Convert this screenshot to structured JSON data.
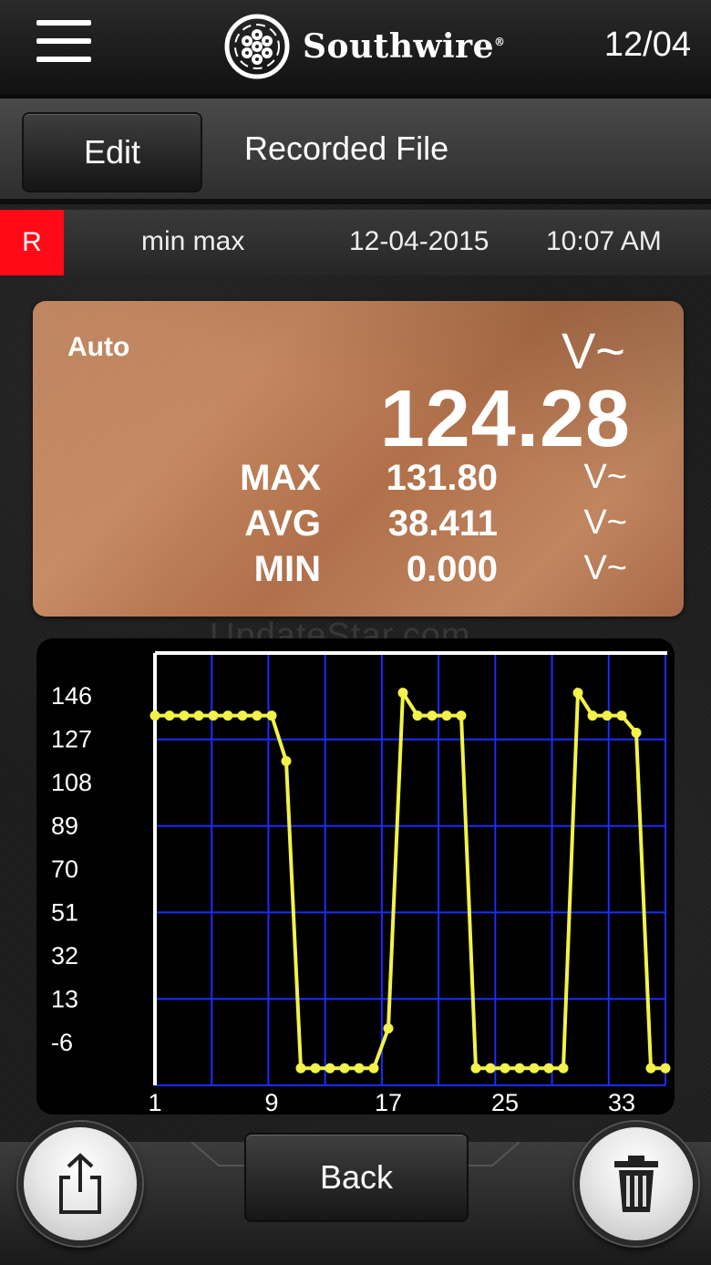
{
  "header": {
    "brand": "Southwire",
    "brand_mark": "®",
    "date": "12/04"
  },
  "titlebar": {
    "edit_label": "Edit",
    "title": "Recorded File"
  },
  "infobar": {
    "badge": "R",
    "mode": "min max",
    "date": "12-04-2015",
    "time": "10:07 AM"
  },
  "reading": {
    "range": "Auto",
    "unit": "V~",
    "value": "124.28",
    "stats": [
      {
        "label": "MAX",
        "value": "131.80",
        "unit": "V~"
      },
      {
        "label": "AVG",
        "value": "38.411",
        "unit": "V~"
      },
      {
        "label": "MIN",
        "value": "0.000",
        "unit": "V~"
      }
    ]
  },
  "watermark": "UpdateStar.com",
  "chart_data": {
    "type": "line",
    "title": "",
    "xlabel": "",
    "ylabel": "",
    "x_ticks": [
      "1",
      "9",
      "17",
      "25",
      "33"
    ],
    "y_ticks": [
      "146",
      "127",
      "108",
      "89",
      "70",
      "51",
      "32",
      "13",
      "-6"
    ],
    "xlim": [
      1,
      36
    ],
    "ylim": [
      -6,
      146
    ],
    "grid": true,
    "series": [
      {
        "color": "#f2f24a",
        "x": [
          1,
          2,
          3,
          4,
          5,
          6,
          7,
          8,
          9,
          10,
          11,
          12,
          13,
          14,
          15,
          16,
          17,
          18,
          19,
          20,
          21,
          22,
          23,
          24,
          25,
          26,
          27,
          28,
          29,
          30,
          31,
          32,
          33,
          34,
          35,
          36
        ],
        "y": [
          124,
          124,
          124,
          124,
          124,
          124,
          124,
          124,
          124,
          108,
          0,
          0,
          0,
          0,
          0,
          0,
          14,
          132,
          124,
          124,
          124,
          124,
          0,
          0,
          0,
          0,
          0,
          0,
          0,
          132,
          124,
          124,
          124,
          118,
          0,
          0
        ]
      }
    ]
  },
  "colors": {
    "accent_red": "#ff0a16",
    "grid": "#1a2cff",
    "line": "#f2f24a"
  },
  "bottombar": {
    "back_label": "Back",
    "share_icon": "share-icon",
    "trash_icon": "trash-icon"
  }
}
